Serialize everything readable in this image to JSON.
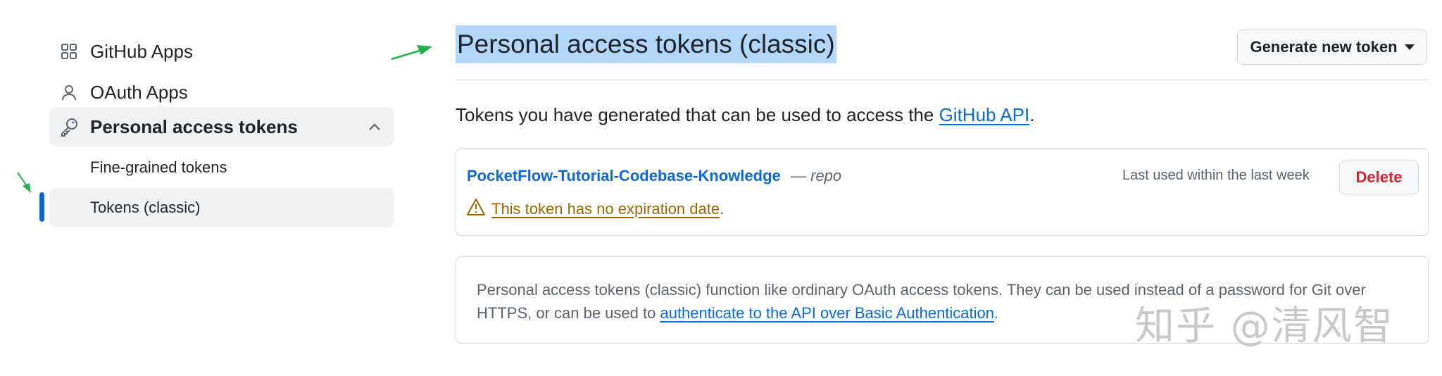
{
  "sidebar": {
    "items": [
      {
        "label": "GitHub Apps",
        "icon": "apps-grid-icon"
      },
      {
        "label": "OAuth Apps",
        "icon": "person-icon"
      },
      {
        "label": "Personal access tokens",
        "icon": "key-icon",
        "expanded": true
      }
    ],
    "sub_items": [
      {
        "label": "Fine-grained tokens",
        "selected": false
      },
      {
        "label": "Tokens (classic)",
        "selected": true
      }
    ]
  },
  "main": {
    "title": "Personal access tokens (classic)",
    "generate_button": "Generate new token",
    "intro_text": "Tokens you have generated that can be used to access the ",
    "intro_link": "GitHub API",
    "intro_end": ".",
    "token": {
      "name": "PocketFlow-Tutorial-Codebase-Knowledge",
      "dash": " — ",
      "scope": "repo",
      "last_used": "Last used within the last week",
      "delete_label": "Delete",
      "warning": "This token has no expiration date",
      "warning_end": "."
    },
    "info": {
      "text": "Personal access tokens (classic) function like ordinary OAuth access tokens. They can be used instead of a password for Git over HTTPS, or can be used to ",
      "link": "authenticate to the API over Basic Authentication",
      "end": "."
    }
  },
  "watermark": "知乎 @清风智",
  "colors": {
    "accent": "#0969da",
    "selection_highlight": "#b3d7fb",
    "danger": "#d1242f",
    "warning": "#9a6700",
    "annotation_arrow": "#22b14c"
  }
}
